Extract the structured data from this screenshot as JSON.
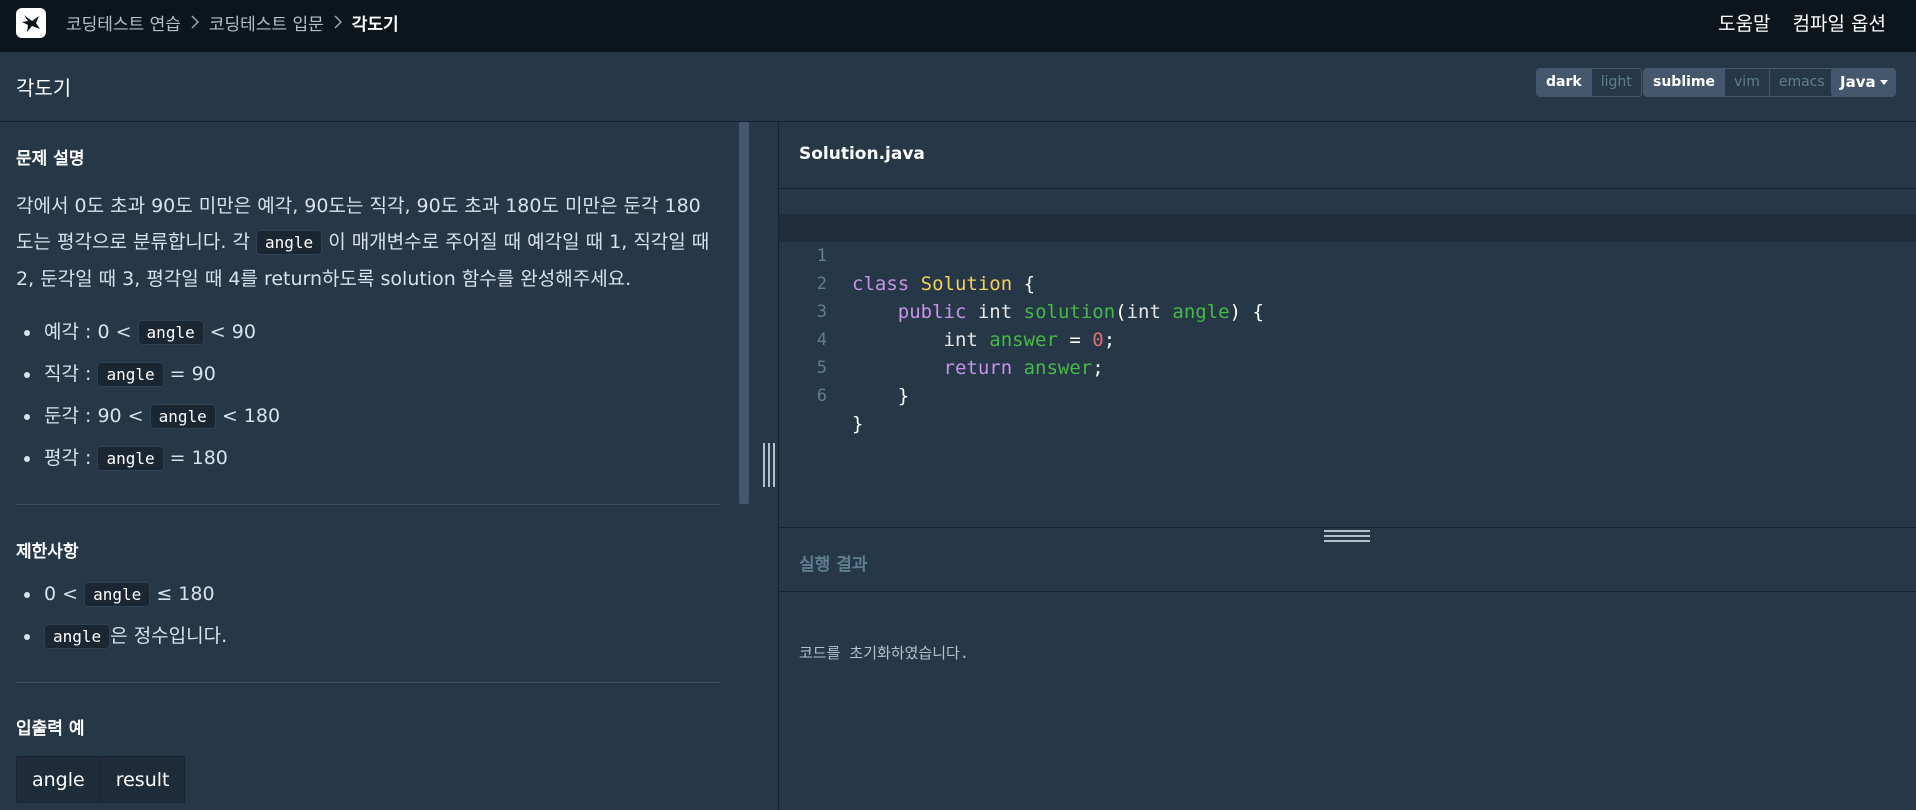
{
  "nav": {
    "breadcrumbs": [
      "코딩테스트 연습",
      "코딩테스트 입문",
      "각도기"
    ],
    "help": "도움말",
    "compile_options": "컴파일 옵션"
  },
  "header": {
    "title": "각도기",
    "theme_options": [
      "dark",
      "light"
    ],
    "keymap_options": [
      "sublime",
      "vim",
      "emacs"
    ],
    "language": "Java"
  },
  "problem": {
    "description_title": "문제 설명",
    "desc_p1": "각에서 0도 초과 90도 미만은 예각, 90도는 직각, 90도 초과 180도 미만은 둔각 180도는 평각으로 분류합니다. 각",
    "desc_code": "angle",
    "desc_p2": "이 매개변수로 주어질 때 예각일 때 1, 직각일 때 2, 둔각일 때 3, 평각일 때 4를 return하도록 solution 함수를 완성해주세요.",
    "bullets": [
      {
        "pre": "예각 : 0 <",
        "code": "angle",
        "post": "< 90"
      },
      {
        "pre": "직각 :",
        "code": "angle",
        "post": "= 90"
      },
      {
        "pre": "둔각 : 90 <",
        "code": "angle",
        "post": "< 180"
      },
      {
        "pre": "평각 :",
        "code": "angle",
        "post": "= 180"
      }
    ],
    "constraints_title": "제한사항",
    "constraints": [
      {
        "pre": "0 <",
        "code": "angle",
        "post": "≤ 180"
      },
      {
        "pre": "",
        "code": "angle",
        "post": "은 정수입니다."
      }
    ],
    "examples_title": "입출력 예",
    "example_headers": [
      "angle",
      "result"
    ]
  },
  "editor": {
    "file_name": "Solution.java",
    "line_numbers": [
      "1",
      "2",
      "3",
      "4",
      "5",
      "6"
    ],
    "code": {
      "l1_kw": "class",
      "l1_cls": "Solution",
      "l1_end": "{",
      "l2_kw": "public",
      "l2_ty": "int",
      "l2_fn": "solution",
      "l2_p1": "(",
      "l2_ty2": "int",
      "l2_var": "angle",
      "l2_end": ") {",
      "l3_ty": "int",
      "l3_var": "answer",
      "l3_eq": "=",
      "l3_num": "0",
      "l3_end": ";",
      "l4_kw": "return",
      "l4_var": "answer",
      "l4_end": ";",
      "l5": "}",
      "l6": "}"
    }
  },
  "result": {
    "title": "실행 결과",
    "message": "코드를 초기화하였습니다."
  }
}
